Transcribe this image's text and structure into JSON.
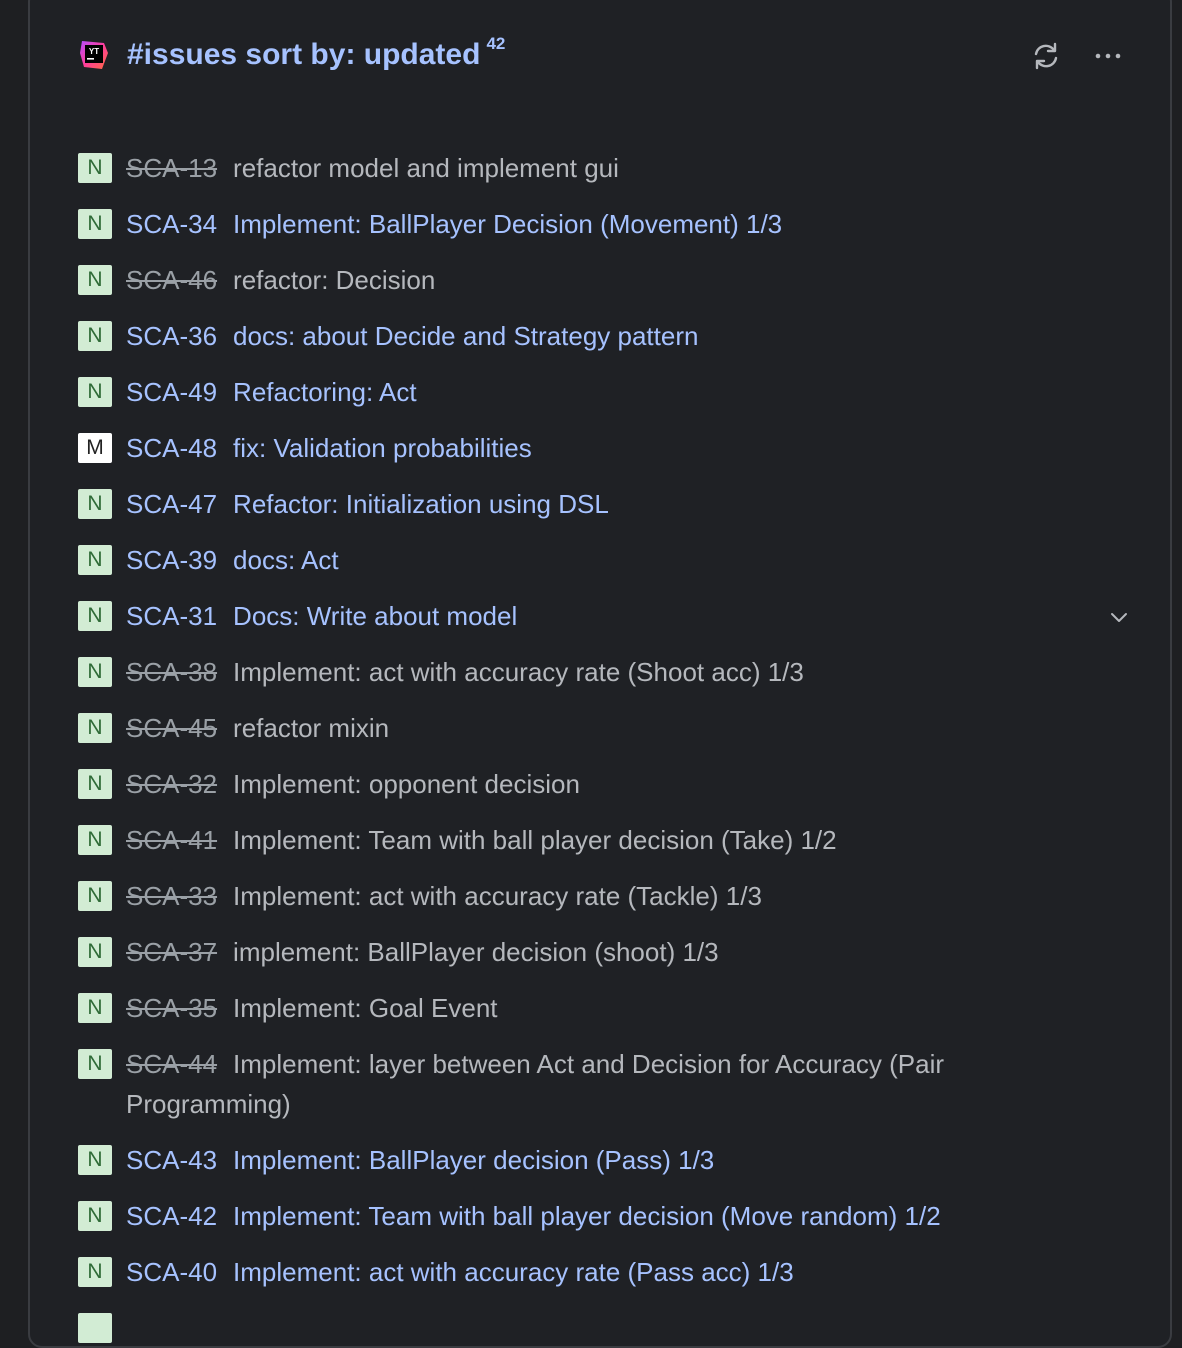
{
  "widget": {
    "title": "#issues sort by: updated",
    "count": "42"
  },
  "colors": {
    "background": "#1f2125",
    "link": "#a6c2ff",
    "resolved": "#b5b8bd",
    "badge_normal_bg": "#d2ecd4",
    "badge_major_bg": "#ffffff"
  },
  "icons": {
    "logo": "youtrack-logo",
    "refresh": "refresh-icon",
    "more": "more-icon",
    "expand": "chevron-down-icon"
  },
  "issues": [
    {
      "id": "SCA-13",
      "summary": "refactor model and implement gui",
      "priority": "N",
      "resolved": true
    },
    {
      "id": "SCA-34",
      "summary": "Implement: BallPlayer Decision (Movement) 1/3",
      "priority": "N",
      "resolved": false
    },
    {
      "id": "SCA-46",
      "summary": "refactor: Decision",
      "priority": "N",
      "resolved": true
    },
    {
      "id": "SCA-36",
      "summary": "docs: about Decide and Strategy pattern",
      "priority": "N",
      "resolved": false
    },
    {
      "id": "SCA-49",
      "summary": "Refactoring: Act",
      "priority": "N",
      "resolved": false
    },
    {
      "id": "SCA-48",
      "summary": "fix: Validation probabilities",
      "priority": "M",
      "resolved": false
    },
    {
      "id": "SCA-47",
      "summary": "Refactor: Initialization using DSL",
      "priority": "N",
      "resolved": false
    },
    {
      "id": "SCA-39",
      "summary": "docs: Act",
      "priority": "N",
      "resolved": false
    },
    {
      "id": "SCA-31",
      "summary": "Docs: Write about model",
      "priority": "N",
      "resolved": false
    },
    {
      "id": "SCA-38",
      "summary": "Implement: act with accuracy rate (Shoot acc) 1/3",
      "priority": "N",
      "resolved": true
    },
    {
      "id": "SCA-45",
      "summary": "refactor mixin",
      "priority": "N",
      "resolved": true
    },
    {
      "id": "SCA-32",
      "summary": "Implement: opponent decision",
      "priority": "N",
      "resolved": true
    },
    {
      "id": "SCA-41",
      "summary": "Implement: Team with ball player decision (Take) 1/2",
      "priority": "N",
      "resolved": true
    },
    {
      "id": "SCA-33",
      "summary": "Implement: act with accuracy rate (Tackle) 1/3",
      "priority": "N",
      "resolved": true
    },
    {
      "id": "SCA-37",
      "summary": "implement: BallPlayer decision (shoot) 1/3",
      "priority": "N",
      "resolved": true
    },
    {
      "id": "SCA-35",
      "summary": "Implement: Goal Event",
      "priority": "N",
      "resolved": true
    },
    {
      "id": "SCA-44",
      "summary": "Implement: layer between Act and Decision for Accuracy (Pair Programming)",
      "priority": "N",
      "resolved": true
    },
    {
      "id": "SCA-43",
      "summary": "Implement: BallPlayer decision (Pass) 1/3",
      "priority": "N",
      "resolved": false
    },
    {
      "id": "SCA-42",
      "summary": "Implement: Team with ball player decision (Move random) 1/2",
      "priority": "N",
      "resolved": false
    },
    {
      "id": "SCA-40",
      "summary": "Implement: act with accuracy rate (Pass acc) 1/3",
      "priority": "N",
      "resolved": false
    },
    {
      "id": "",
      "summary": "",
      "priority": "N",
      "resolved": false
    }
  ]
}
